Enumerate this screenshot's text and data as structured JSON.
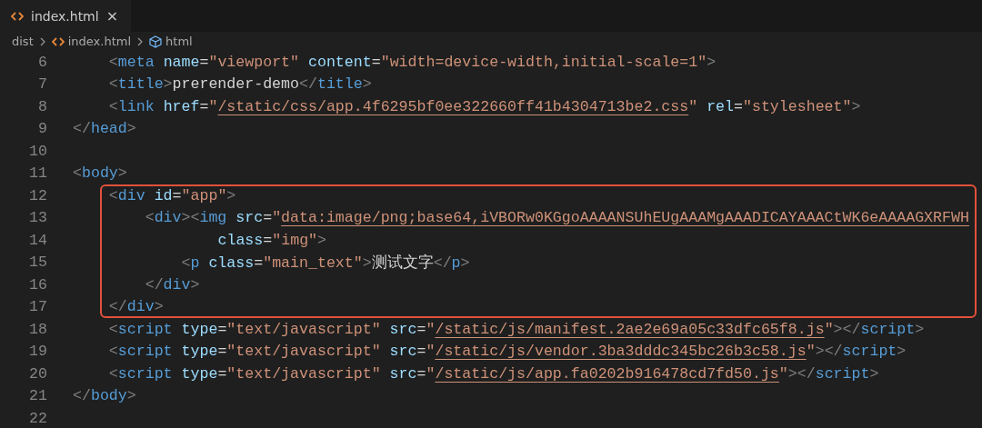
{
  "tabs": [
    {
      "label": "index.html",
      "close": "×",
      "selected": true
    }
  ],
  "breadcrumb": [
    {
      "label": "dist",
      "kind": "folder"
    },
    {
      "label": "index.html",
      "kind": "file"
    },
    {
      "label": "html",
      "kind": "element"
    }
  ],
  "sections": [
    {
      "kind": "plain",
      "lines": [
        {
          "number": "6",
          "code": "    <meta name=\"viewport\" content=\"width=device-width,initial-scale=1\">"
        },
        {
          "number": "7",
          "code": "    <title>prerender-demo</title>"
        },
        {
          "number": "8",
          "code": "    <link href=\"/static/css/app.4f6295bf0ee322660ff41b4304713be2.css\" rel=\"stylesheet\">"
        },
        {
          "number": "9",
          "code": "</head>"
        },
        {
          "number": "10"
        },
        {
          "number": "11",
          "code": "<body>"
        }
      ]
    },
    {
      "kind": "boxed",
      "lines": [
        {
          "number": "12",
          "code": "    <div id=\"app\">"
        },
        {
          "number": "13",
          "code": "        <div><img src=\"data:image/png;base64,iVBORw0KGgoAAAANSUhEUgAAAMgAAADICAYAAACtWK6eAAAAGXRFWH"
        },
        {
          "number": "14",
          "code": "                class=\"img\">"
        },
        {
          "number": "15",
          "code": "            <p class=\"main_text\">测试文字</p>"
        },
        {
          "number": "16",
          "code": "        </div>"
        },
        {
          "number": "17",
          "code": "    </div>"
        }
      ]
    },
    {
      "kind": "plain",
      "lines": [
        {
          "number": "18",
          "code": "    <script type=\"text/javascript\" src=\"/static/js/manifest.2ae2e69a05c33dfc65f8.js\"></script>"
        },
        {
          "number": "19",
          "code": "    <script type=\"text/javascript\" src=\"/static/js/vendor.3ba3dddc345bc26b3c58.js\"></script>"
        },
        {
          "number": "20",
          "code": "    <script type=\"text/javascript\" src=\"/static/js/app.fa0202b916478cd7fd50.js\"></script>"
        },
        {
          "number": "21",
          "code": "</body>"
        },
        {
          "number": "22"
        }
      ]
    }
  ]
}
